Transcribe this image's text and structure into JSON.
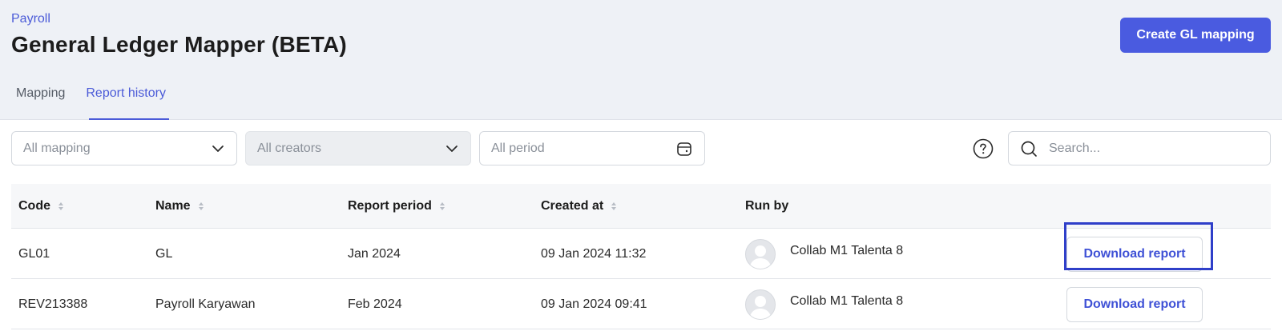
{
  "header": {
    "breadcrumb": "Payroll",
    "title": "General Ledger Mapper (BETA)",
    "create_button": "Create GL mapping"
  },
  "tabs": [
    {
      "label": "Mapping",
      "active": false
    },
    {
      "label": "Report history",
      "active": true
    }
  ],
  "filters": {
    "mapping": "All mapping",
    "creators": "All creators",
    "period": "All period",
    "search_placeholder": "Search..."
  },
  "table": {
    "columns": [
      "Code",
      "Name",
      "Report period",
      "Created at",
      "Run by"
    ],
    "rows": [
      {
        "code": "GL01",
        "name": "GL",
        "period": "Jan 2024",
        "created_at": "09 Jan 2024 11:32",
        "run_by": "Collab M1 Talenta 8",
        "action": "Download report"
      },
      {
        "code": "REV213388",
        "name": "Payroll Karyawan",
        "period": "Feb 2024",
        "created_at": "09 Jan 2024 09:41",
        "run_by": "Collab M1 Talenta 8",
        "action": "Download report"
      }
    ]
  },
  "icons": {
    "chevron": "chevron-down-icon",
    "calendar": "calendar-icon",
    "help": "help-icon",
    "search": "search-icon",
    "sort": "sort-icon",
    "avatar": "avatar-icon"
  },
  "colors": {
    "accent": "#4a5be0",
    "header_bg": "#eef1f6",
    "highlight": "#2f3fc9"
  }
}
